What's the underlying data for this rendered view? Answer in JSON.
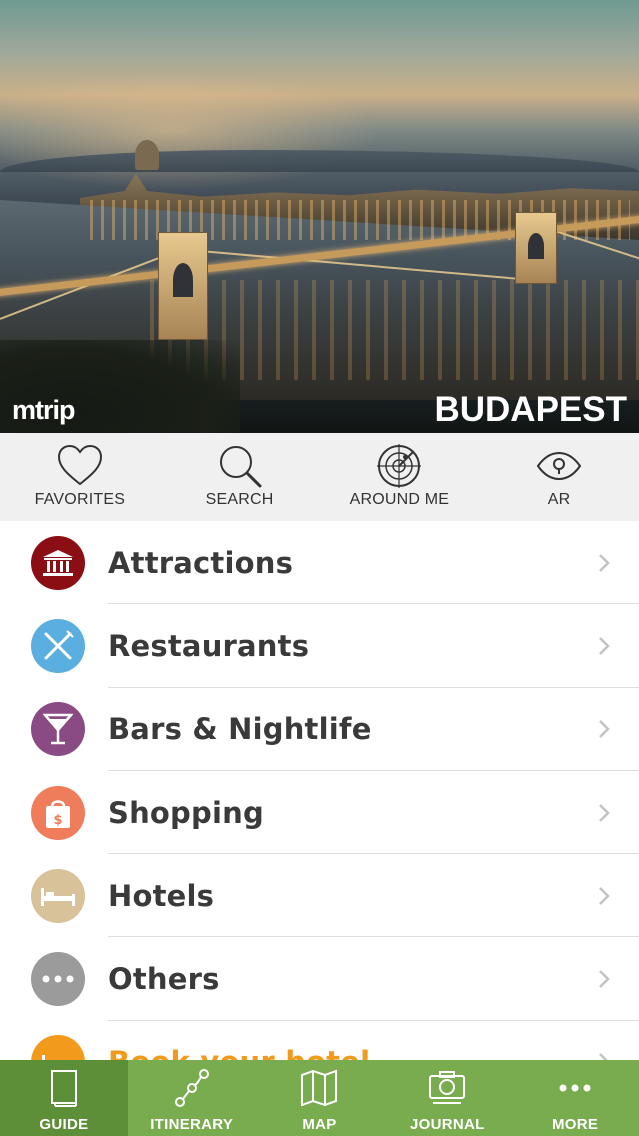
{
  "hero": {
    "brand": "mtrip",
    "city": "BUDAPEST"
  },
  "quick_actions": [
    {
      "label": "FAVORITES",
      "icon": "heart-icon"
    },
    {
      "label": "SEARCH",
      "icon": "search-icon"
    },
    {
      "label": "AROUND ME",
      "icon": "radar-icon"
    },
    {
      "label": "AR",
      "icon": "eye-icon"
    }
  ],
  "categories": [
    {
      "label": "Attractions",
      "icon": "museum-icon",
      "color": "#8b0e15"
    },
    {
      "label": "Restaurants",
      "icon": "fork-knife-icon",
      "color": "#5aaee0"
    },
    {
      "label": "Bars & Nightlife",
      "icon": "cocktail-icon",
      "color": "#8a4a83"
    },
    {
      "label": "Shopping",
      "icon": "shopping-bag-icon",
      "color": "#ef7c5a"
    },
    {
      "label": "Hotels",
      "icon": "bed-icon",
      "color": "#d8c29a"
    },
    {
      "label": "Others",
      "icon": "more-dots-icon",
      "color": "#9b9b9b"
    },
    {
      "label": "Book your hotel",
      "icon": "hotel-booking-icon",
      "color": "#f29a1b"
    }
  ],
  "tabs": [
    {
      "label": "GUIDE",
      "icon": "guide-book-icon",
      "active": true
    },
    {
      "label": "ITINERARY",
      "icon": "itinerary-icon",
      "active": false
    },
    {
      "label": "MAP",
      "icon": "map-icon",
      "active": false
    },
    {
      "label": "JOURNAL",
      "icon": "camera-icon",
      "active": false
    },
    {
      "label": "MORE",
      "icon": "more-icon",
      "active": false
    }
  ],
  "colors": {
    "tabbar": "#79ac4f",
    "tab_active": "#5d8e38",
    "quickbar_bg": "#f0f0f0",
    "accent_orange": "#f29a1b"
  }
}
